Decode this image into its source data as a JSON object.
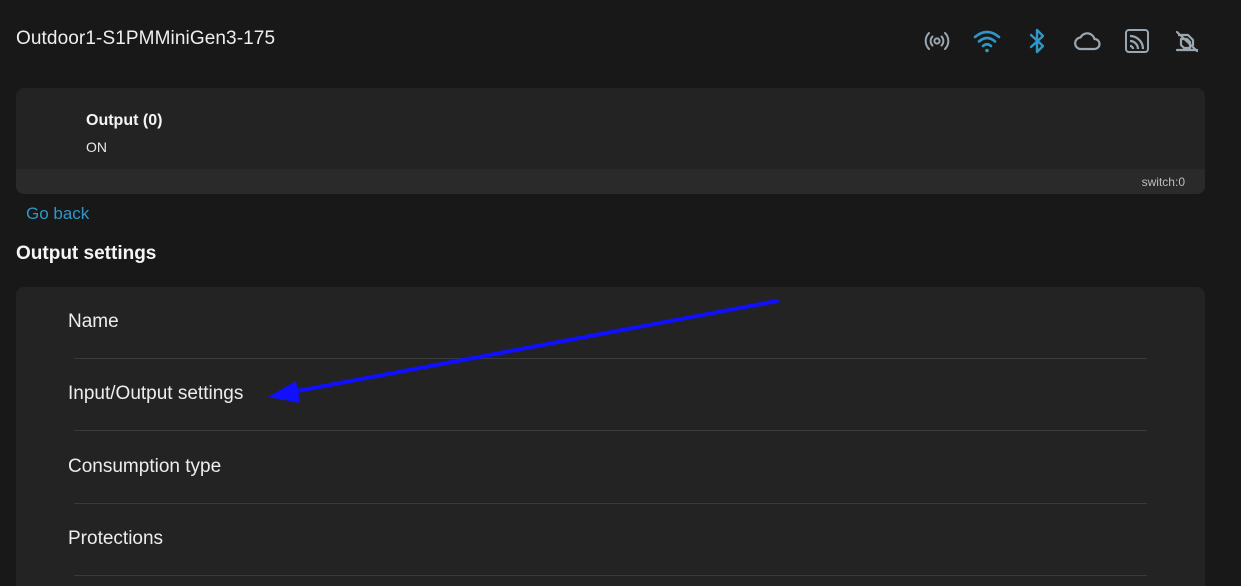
{
  "header": {
    "title": "Outdoor1-S1PMMiniGen3-175",
    "status_icons": [
      "ap-broadcast-icon",
      "wifi-icon",
      "bluetooth-icon",
      "cloud-icon",
      "mqtt-icon",
      "websocket-disabled-icon"
    ]
  },
  "output_card": {
    "name": "Output (0)",
    "state": "ON",
    "component_id": "switch:0"
  },
  "nav": {
    "go_back": "Go back"
  },
  "section": {
    "heading": "Output settings",
    "items": [
      {
        "label": "Name"
      },
      {
        "label": "Input/Output settings"
      },
      {
        "label": "Consumption type"
      },
      {
        "label": "Protections"
      }
    ]
  },
  "colors": {
    "background": "#181818",
    "card": "#232323",
    "accent_blue": "#2f97c8",
    "icon_gray": "#9aa7b0",
    "annotation_arrow": "#1010ff"
  }
}
